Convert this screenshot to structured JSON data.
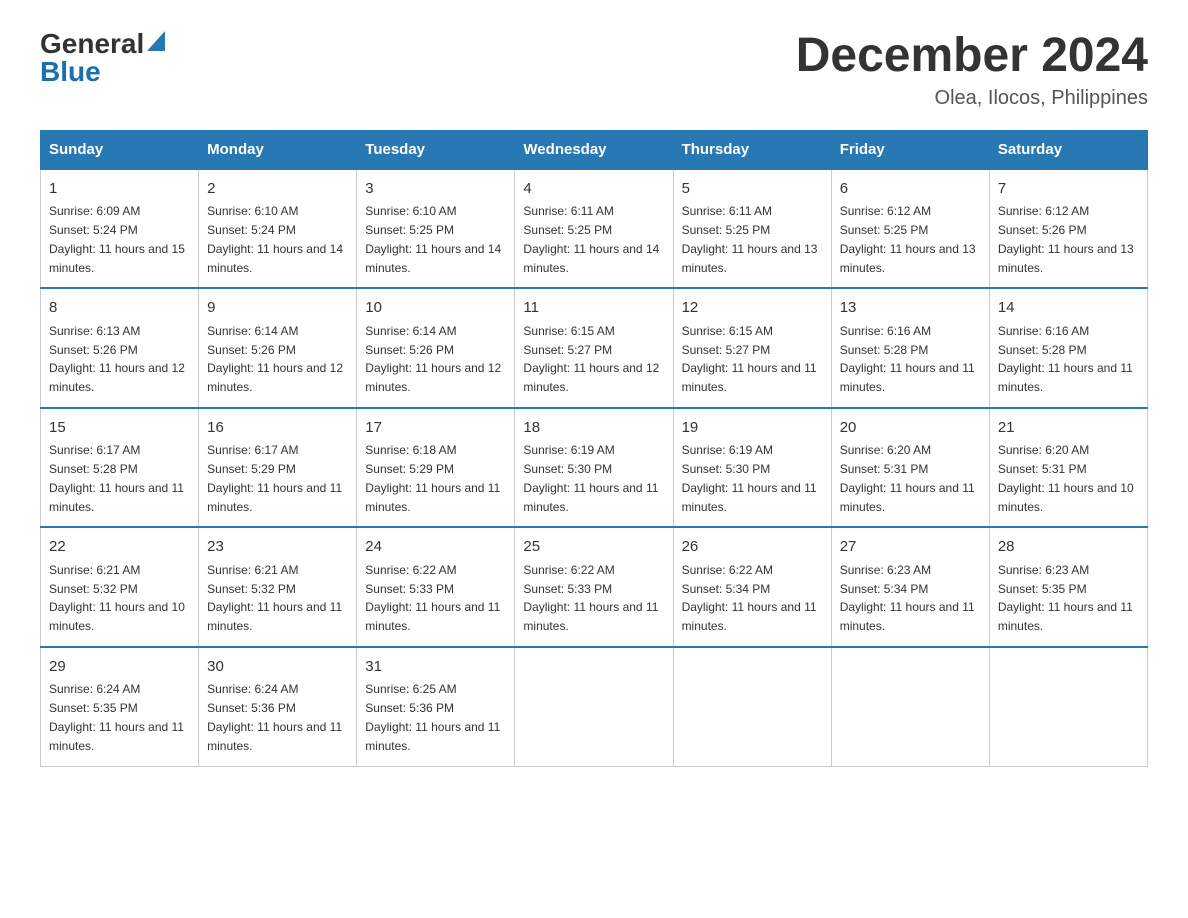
{
  "logo": {
    "text_general": "General",
    "text_blue": "Blue",
    "triangle": "▶"
  },
  "title": {
    "month": "December 2024",
    "location": "Olea, Ilocos, Philippines"
  },
  "days_of_week": [
    "Sunday",
    "Monday",
    "Tuesday",
    "Wednesday",
    "Thursday",
    "Friday",
    "Saturday"
  ],
  "weeks": [
    [
      {
        "day": "1",
        "sunrise": "6:09 AM",
        "sunset": "5:24 PM",
        "daylight": "11 hours and 15 minutes."
      },
      {
        "day": "2",
        "sunrise": "6:10 AM",
        "sunset": "5:24 PM",
        "daylight": "11 hours and 14 minutes."
      },
      {
        "day": "3",
        "sunrise": "6:10 AM",
        "sunset": "5:25 PM",
        "daylight": "11 hours and 14 minutes."
      },
      {
        "day": "4",
        "sunrise": "6:11 AM",
        "sunset": "5:25 PM",
        "daylight": "11 hours and 14 minutes."
      },
      {
        "day": "5",
        "sunrise": "6:11 AM",
        "sunset": "5:25 PM",
        "daylight": "11 hours and 13 minutes."
      },
      {
        "day": "6",
        "sunrise": "6:12 AM",
        "sunset": "5:25 PM",
        "daylight": "11 hours and 13 minutes."
      },
      {
        "day": "7",
        "sunrise": "6:12 AM",
        "sunset": "5:26 PM",
        "daylight": "11 hours and 13 minutes."
      }
    ],
    [
      {
        "day": "8",
        "sunrise": "6:13 AM",
        "sunset": "5:26 PM",
        "daylight": "11 hours and 12 minutes."
      },
      {
        "day": "9",
        "sunrise": "6:14 AM",
        "sunset": "5:26 PM",
        "daylight": "11 hours and 12 minutes."
      },
      {
        "day": "10",
        "sunrise": "6:14 AM",
        "sunset": "5:26 PM",
        "daylight": "11 hours and 12 minutes."
      },
      {
        "day": "11",
        "sunrise": "6:15 AM",
        "sunset": "5:27 PM",
        "daylight": "11 hours and 12 minutes."
      },
      {
        "day": "12",
        "sunrise": "6:15 AM",
        "sunset": "5:27 PM",
        "daylight": "11 hours and 11 minutes."
      },
      {
        "day": "13",
        "sunrise": "6:16 AM",
        "sunset": "5:28 PM",
        "daylight": "11 hours and 11 minutes."
      },
      {
        "day": "14",
        "sunrise": "6:16 AM",
        "sunset": "5:28 PM",
        "daylight": "11 hours and 11 minutes."
      }
    ],
    [
      {
        "day": "15",
        "sunrise": "6:17 AM",
        "sunset": "5:28 PM",
        "daylight": "11 hours and 11 minutes."
      },
      {
        "day": "16",
        "sunrise": "6:17 AM",
        "sunset": "5:29 PM",
        "daylight": "11 hours and 11 minutes."
      },
      {
        "day": "17",
        "sunrise": "6:18 AM",
        "sunset": "5:29 PM",
        "daylight": "11 hours and 11 minutes."
      },
      {
        "day": "18",
        "sunrise": "6:19 AM",
        "sunset": "5:30 PM",
        "daylight": "11 hours and 11 minutes."
      },
      {
        "day": "19",
        "sunrise": "6:19 AM",
        "sunset": "5:30 PM",
        "daylight": "11 hours and 11 minutes."
      },
      {
        "day": "20",
        "sunrise": "6:20 AM",
        "sunset": "5:31 PM",
        "daylight": "11 hours and 11 minutes."
      },
      {
        "day": "21",
        "sunrise": "6:20 AM",
        "sunset": "5:31 PM",
        "daylight": "11 hours and 10 minutes."
      }
    ],
    [
      {
        "day": "22",
        "sunrise": "6:21 AM",
        "sunset": "5:32 PM",
        "daylight": "11 hours and 10 minutes."
      },
      {
        "day": "23",
        "sunrise": "6:21 AM",
        "sunset": "5:32 PM",
        "daylight": "11 hours and 11 minutes."
      },
      {
        "day": "24",
        "sunrise": "6:22 AM",
        "sunset": "5:33 PM",
        "daylight": "11 hours and 11 minutes."
      },
      {
        "day": "25",
        "sunrise": "6:22 AM",
        "sunset": "5:33 PM",
        "daylight": "11 hours and 11 minutes."
      },
      {
        "day": "26",
        "sunrise": "6:22 AM",
        "sunset": "5:34 PM",
        "daylight": "11 hours and 11 minutes."
      },
      {
        "day": "27",
        "sunrise": "6:23 AM",
        "sunset": "5:34 PM",
        "daylight": "11 hours and 11 minutes."
      },
      {
        "day": "28",
        "sunrise": "6:23 AM",
        "sunset": "5:35 PM",
        "daylight": "11 hours and 11 minutes."
      }
    ],
    [
      {
        "day": "29",
        "sunrise": "6:24 AM",
        "sunset": "5:35 PM",
        "daylight": "11 hours and 11 minutes."
      },
      {
        "day": "30",
        "sunrise": "6:24 AM",
        "sunset": "5:36 PM",
        "daylight": "11 hours and 11 minutes."
      },
      {
        "day": "31",
        "sunrise": "6:25 AM",
        "sunset": "5:36 PM",
        "daylight": "11 hours and 11 minutes."
      },
      {
        "day": "",
        "sunrise": "",
        "sunset": "",
        "daylight": ""
      },
      {
        "day": "",
        "sunrise": "",
        "sunset": "",
        "daylight": ""
      },
      {
        "day": "",
        "sunrise": "",
        "sunset": "",
        "daylight": ""
      },
      {
        "day": "",
        "sunrise": "",
        "sunset": "",
        "daylight": ""
      }
    ]
  ]
}
